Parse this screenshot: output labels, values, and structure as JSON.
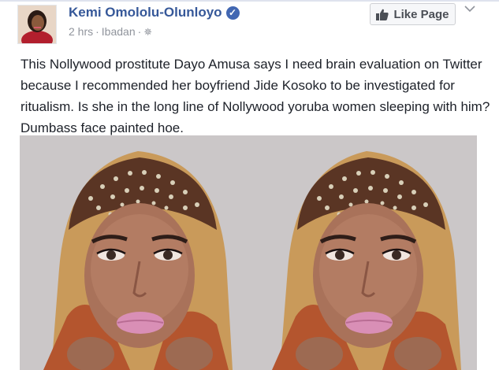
{
  "post": {
    "author": "Kemi Omololu-Olunloyo",
    "time": "2 hrs",
    "location": "Ibadan",
    "text": "This Nollywood prostitute Dayo Amusa says I need brain evaluation on Twitter because I recommended her boyfriend Jide Kosoko to be investigated for ritualism. Is she in the long line of Nollywood yoruba women sleeping with him? Dumbass face painted hoe."
  },
  "actions": {
    "like_page": "Like Page"
  },
  "icons": {
    "verified": "verified-badge-icon",
    "privacy": "public-globe-icon",
    "like": "thumbs-up-icon",
    "menu": "chevron-down-icon"
  },
  "colors": {
    "link": "#365899",
    "verified": "#4267b2",
    "meta": "#90949c",
    "text": "#1d2129"
  }
}
